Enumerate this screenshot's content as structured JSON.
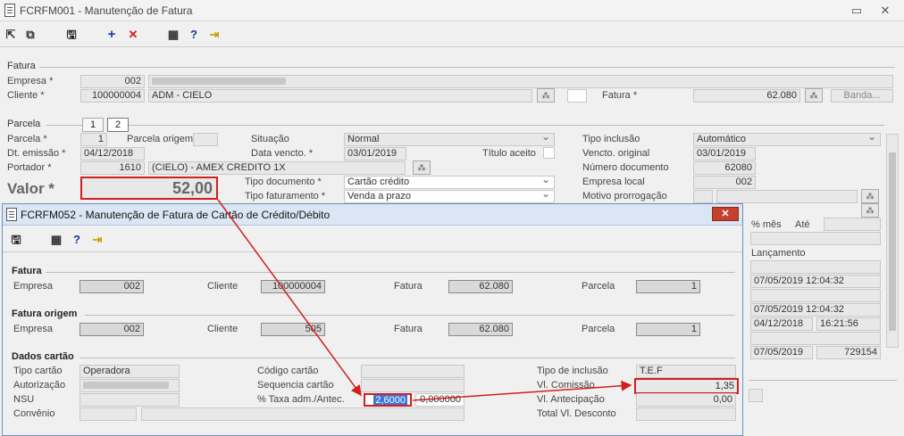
{
  "main": {
    "title": "FCRFM001 - Manutenção de Fatura",
    "toolbar": [
      "save",
      "add",
      "delete",
      "calculator",
      "help",
      "exit"
    ],
    "fatura": {
      "group": "Fatura",
      "empresa_label": "Empresa *",
      "empresa": "002",
      "cliente_label": "Cliente *",
      "cliente": "100000004",
      "cliente_nome": "ADM - CIELO",
      "fatura_label": "Fatura *",
      "fatura": "62.080",
      "banda": "Banda..."
    },
    "parcela": {
      "group": "Parcela",
      "tab1": "1",
      "tab2": "2",
      "parcela_label": "Parcela *",
      "parcela": "1",
      "parcela_origem_label": "Parcela origem",
      "dt_emissao_label": "Dt. emissão *",
      "dt_emissao": "04/12/2018",
      "portador_label": "Portador *",
      "portador": "1610",
      "portador_nome": "(CIELO) - AMEX CREDITO 1X",
      "valor_label": "Valor *",
      "valor": "52,00",
      "situacao_label": "Situação",
      "situacao": "Normal",
      "data_vencto_label": "Data vencto. *",
      "data_vencto": "03/01/2019",
      "titulo_aceito_label": "Título aceito",
      "tipo_documento_label": "Tipo documento *",
      "tipo_documento": "Cartão crédito",
      "tipo_faturamento_label": "Tipo faturamento *",
      "tipo_faturamento": "Venda a prazo",
      "tipo_inclusao_label": "Tipo inclusão",
      "tipo_inclusao": "Automático",
      "vencto_original_label": "Vencto. original",
      "vencto_original": "03/01/2019",
      "numero_documento_label": "Número documento",
      "numero_documento": "62080",
      "empresa_local_label": "Empresa local",
      "empresa_local": "002",
      "motivo_prorrogacao_label": "Motivo prorrogação",
      "pct_mes_label": "% mês",
      "ate_label": "Até",
      "lancamento_label": "Lançamento",
      "ts1": "07/05/2019 12:04:32",
      "ts2": "07/05/2019 12:04:32",
      "dt3": "04/12/2018",
      "time3": "16:21:56",
      "dt4": "07/05/2019",
      "num4": "729154"
    }
  },
  "sub": {
    "title": "FCRFM052 - Manutenção de Fatura de Cartão de Crédito/Débito",
    "fatura": {
      "group": "Fatura",
      "empresa_label": "Empresa",
      "empresa": "002",
      "cliente_label": "Cliente",
      "cliente": "100000004",
      "fatura_label": "Fatura",
      "fatura": "62.080",
      "parcela_label": "Parcela",
      "parcela": "1"
    },
    "fatura_origem": {
      "group": "Fatura origem",
      "empresa_label": "Empresa",
      "empresa": "002",
      "cliente_label": "Cliente",
      "cliente": "505",
      "fatura_label": "Fatura",
      "fatura": "62.080",
      "parcela_label": "Parcela",
      "parcela": "1"
    },
    "dados_cartao": {
      "group": "Dados cartão",
      "tipo_cartao_label": "Tipo cartão",
      "tipo_cartao": "Operadora",
      "autorizacao_label": "Autorização",
      "nsu_label": "NSU",
      "convenio_label": "Convênio",
      "codigo_cartao_label": "Código cartão",
      "sequencia_cartao_label": "Sequencia cartão",
      "taxa_label": "% Taxa adm./Antec.",
      "taxa_adm": "2,6000",
      "taxa_antec": "0,000000",
      "tipo_inclusao_label": "Tipo de inclusão",
      "tipo_inclusao": "T.E.F",
      "vl_comissao_label": "Vl. Comissão",
      "vl_comissao": "1,35",
      "vl_antecipacao_label": "Vl. Antecipação",
      "vl_antecipacao": "0,00",
      "total_vl_desconto_label": "Total Vl. Desconto"
    }
  },
  "annotation_color": "#d21e1e"
}
